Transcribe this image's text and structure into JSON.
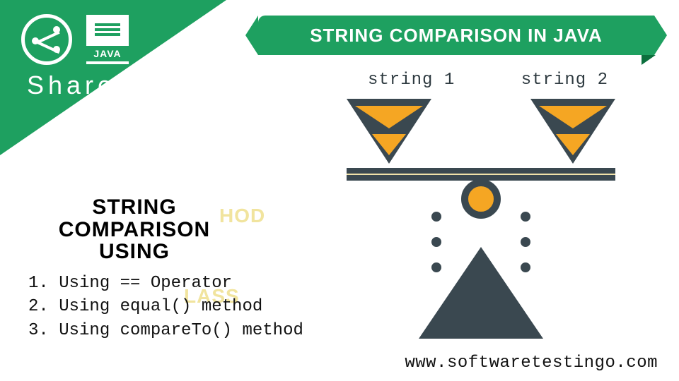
{
  "share": {
    "label": "Share",
    "ext": "JAVA"
  },
  "ribbon": {
    "title": "STRING COMPARISON IN JAVA"
  },
  "scale": {
    "label_left": "string 1",
    "label_right": "string 2"
  },
  "methods": {
    "heading_l1": "STRING COMPARISON",
    "heading_l2": "USING",
    "items": [
      "Using == Operator",
      "Using  equal() method",
      "Using compareTo() method"
    ],
    "ghost1": "HOD",
    "ghost2": "LASS"
  },
  "footer": {
    "website": "www.softwaretestingo.com"
  }
}
